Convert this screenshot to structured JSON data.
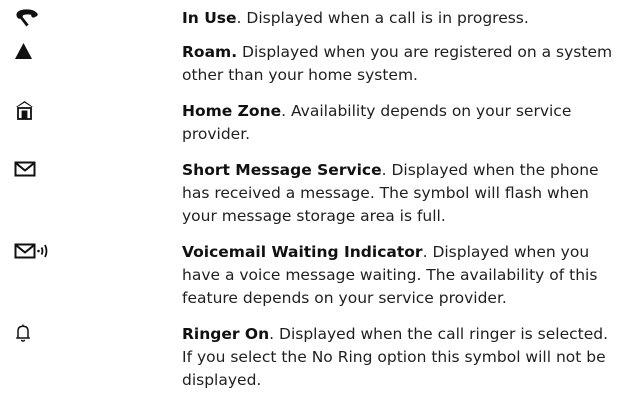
{
  "entries": [
    {
      "icon": "in-use-handset-icon",
      "term": "In Use",
      "sep": ".",
      "description": " Displayed when a call is in progress."
    },
    {
      "icon": "roam-triangle-icon",
      "term": "Roam.",
      "sep": "",
      "description": " Displayed when you are registered on a system other than your home system."
    },
    {
      "icon": "home-zone-icon",
      "term": "Home Zone",
      "sep": ".",
      "description": " Availability depends on your service provider."
    },
    {
      "icon": "envelope-icon",
      "term": "Short Message Service",
      "sep": ".",
      "description": " Displayed when the phone has received a message. The symbol will flash when your message storage area is full."
    },
    {
      "icon": "voicemail-envelope-icon",
      "term": "Voicemail Waiting Indicator",
      "sep": ".",
      "description": " Displayed when you have a voice message waiting. The availability of this feature depends on your service provider."
    },
    {
      "icon": "bell-icon",
      "term": "Ringer On",
      "sep": ".",
      "description": " Displayed when the call ringer is selected. If you select the No Ring option this symbol will not be displayed."
    }
  ]
}
